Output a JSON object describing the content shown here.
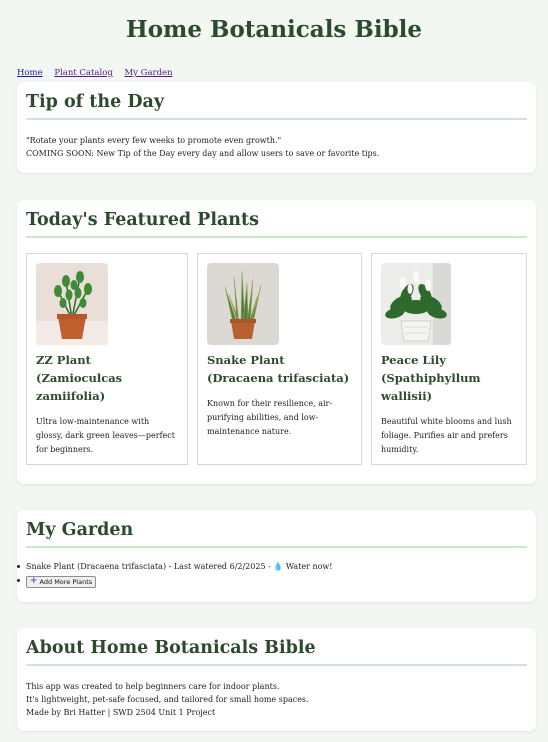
{
  "site": {
    "title": "Home Botanicals Bible"
  },
  "nav": {
    "home": "Home",
    "catalog": "Plant Catalog",
    "garden": "My Garden"
  },
  "tip": {
    "heading": "Tip of the Day",
    "quote": "\"Rotate your plants every few weeks to promote even growth.\"",
    "coming_soon": "COMING SOON: New Tip of the Day every day and allow users to save or favorite tips."
  },
  "featured": {
    "heading": "Today's Featured Plants",
    "plants": [
      {
        "name": "ZZ Plant (Zamioculcas zamiifolia)",
        "description": "Ultra low-maintenance with glossy, dark green leaves—perfect for beginners."
      },
      {
        "name": "Snake Plant (Dracaena trifasciata)",
        "description": "Known for their resilience, air-purifying abilities, and low-maintenance nature."
      },
      {
        "name": "Peace Lily (Spathiphyllum wallisii)",
        "description": "Beautiful white blooms and lush foliage. Purifies air and prefers humidity."
      }
    ]
  },
  "garden": {
    "heading": "My Garden",
    "entry": "Snake Plant (Dracaena trifasciata) - Last watered 6/2/2025 - ",
    "water_icon": "💧",
    "water_label": " Water now!",
    "add_icon": "plus-icon",
    "add_label": "Add More Plants"
  },
  "about": {
    "heading": "About Home Botanicals Bible",
    "line1": "This app was created to help beginners care for indoor plants.",
    "line2": "It's lightweight, pet-safe focused, and tailored for small home spaces.",
    "credit": "Made by Bri Hatter | SWD 2504 Unit 1 Project"
  },
  "colors": {
    "heading": "#2c4a2e",
    "accent_rule": "#cfe5cf",
    "page_bg": "#f2f7f1"
  }
}
